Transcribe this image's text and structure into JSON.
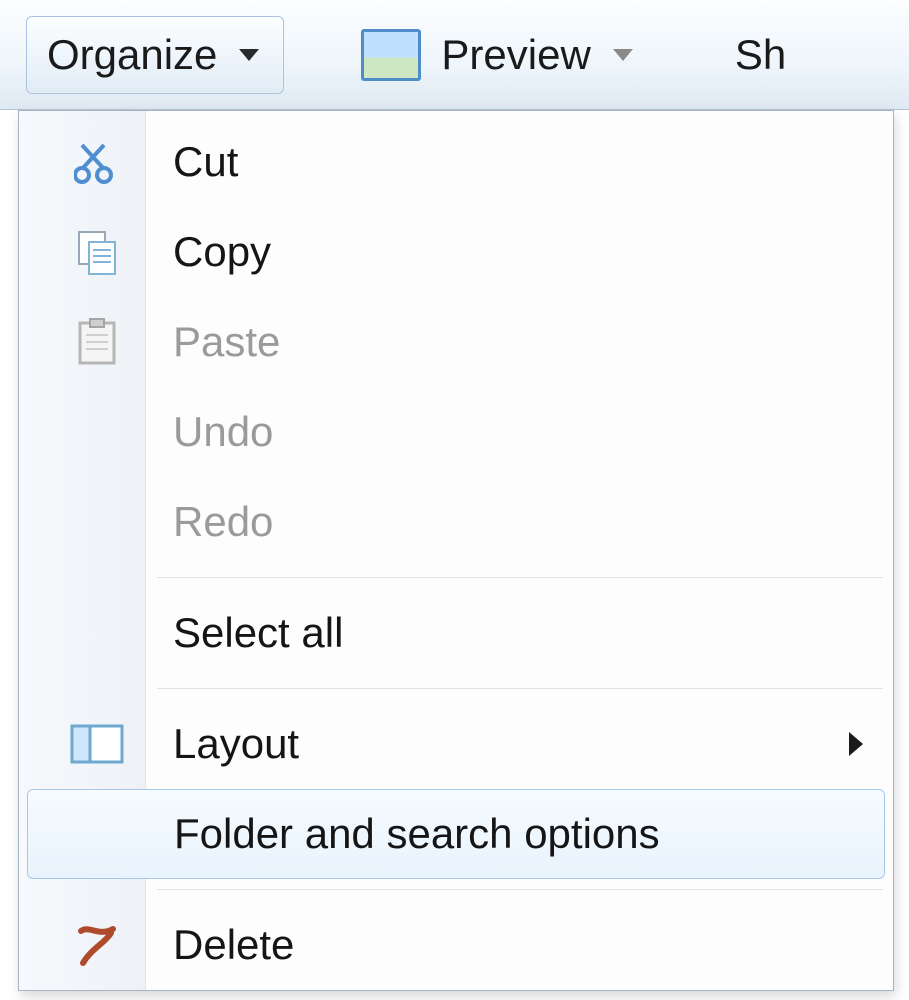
{
  "toolbar": {
    "organize_label": "Organize",
    "preview_label": "Preview",
    "partial_label": "Sh"
  },
  "menu": {
    "cut": {
      "label": "Cut",
      "enabled": true
    },
    "copy": {
      "label": "Copy",
      "enabled": true
    },
    "paste": {
      "label": "Paste",
      "enabled": false
    },
    "undo": {
      "label": "Undo",
      "enabled": false
    },
    "redo": {
      "label": "Redo",
      "enabled": false
    },
    "select_all": {
      "label": "Select all",
      "enabled": true
    },
    "layout": {
      "label": "Layout",
      "enabled": true,
      "has_submenu": true
    },
    "folder_opts": {
      "label": "Folder and search options",
      "enabled": true,
      "hovered": true
    },
    "delete": {
      "label": "Delete",
      "enabled": true
    }
  }
}
